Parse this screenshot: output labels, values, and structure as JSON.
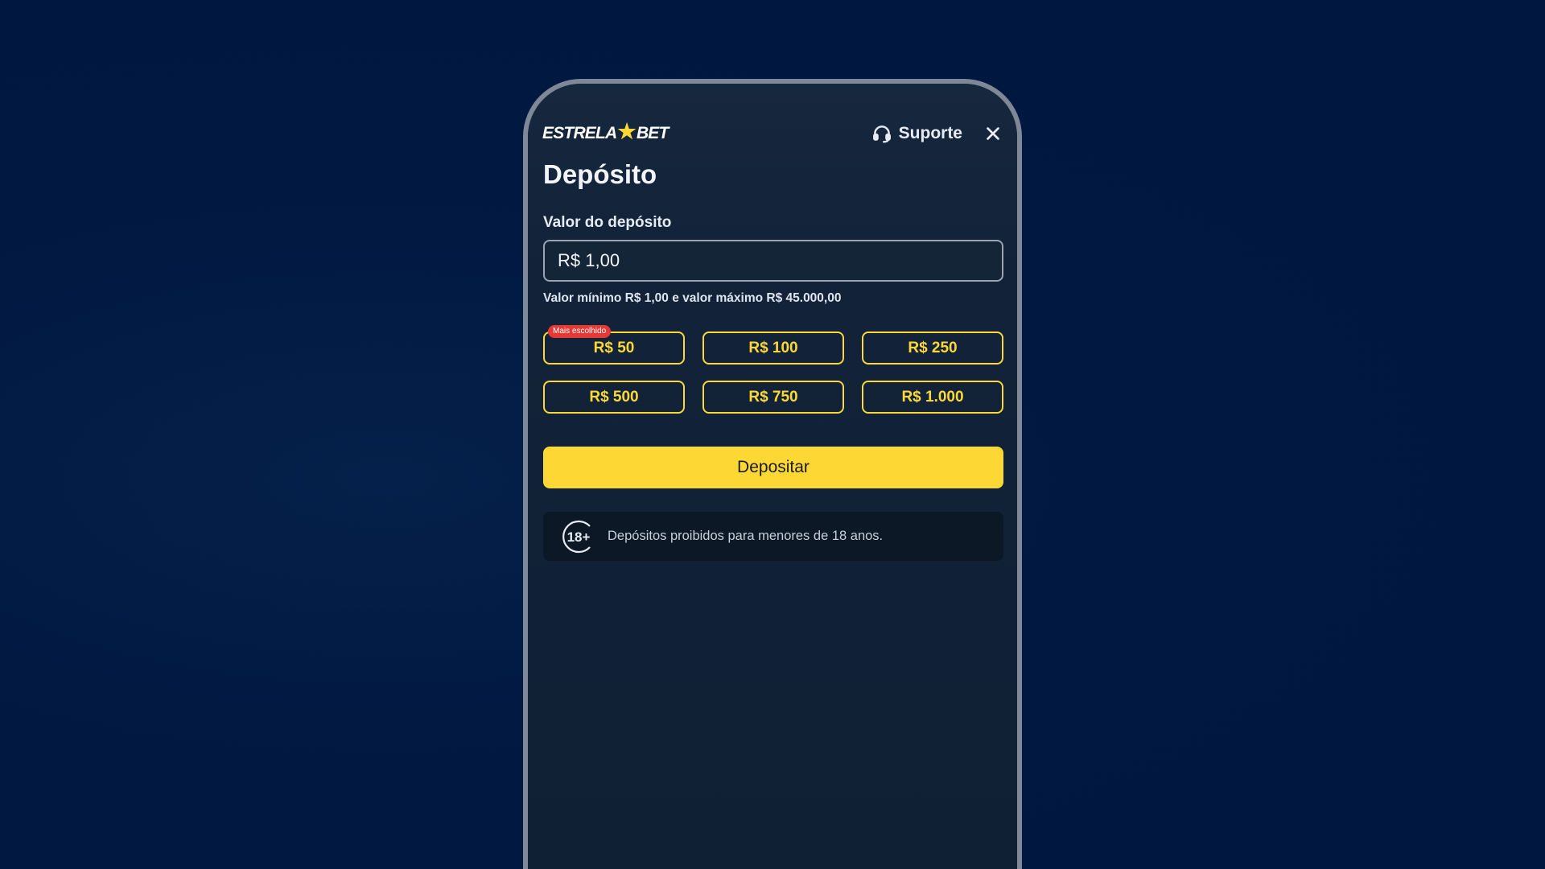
{
  "header": {
    "logo_left": "ESTRELA",
    "logo_right": "BET",
    "support_label": "Suporte"
  },
  "page": {
    "title": "Depósito"
  },
  "deposit_form": {
    "field_label": "Valor do depósito",
    "amount_value": "R$ 1,00",
    "limits_text": "Valor mínimo R$ 1,00 e valor máximo R$ 45.000,00",
    "badge_label": "Mais escolhido",
    "amounts": [
      "R$ 50",
      "R$ 100",
      "R$ 250",
      "R$ 500",
      "R$ 750",
      "R$ 1.000"
    ],
    "submit_label": "Depositar"
  },
  "notice": {
    "age_badge": "18+",
    "text": "Depósitos proibidos para menores de 18 anos."
  },
  "colors": {
    "accent": "#fdd835",
    "badge": "#e53935",
    "background": "#011840",
    "panel": "#122238"
  },
  "icons": [
    "headset-icon",
    "close-icon",
    "star-icon",
    "age-18-icon"
  ]
}
